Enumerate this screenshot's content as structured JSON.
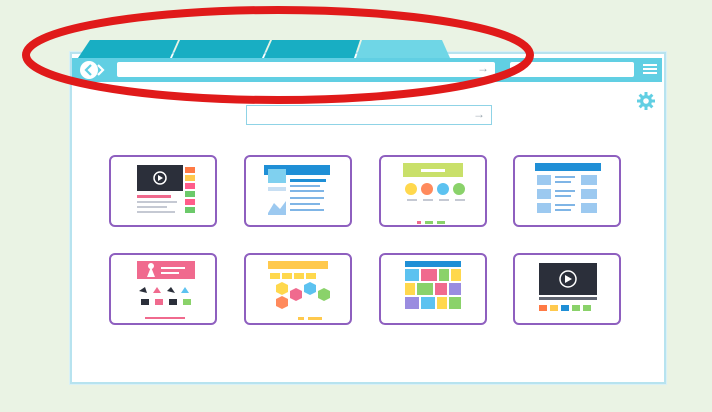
{
  "window": {
    "title": ""
  },
  "tabs": [
    {
      "label": "",
      "active": false
    },
    {
      "label": "",
      "active": false
    },
    {
      "label": "",
      "active": false
    },
    {
      "label": "",
      "active": true
    }
  ],
  "toolbar": {
    "address_value": "",
    "address_icon": "arrow-right-icon",
    "back_icon": "chevron-left-icon",
    "forward_icon": "chevron-right-icon",
    "menu_icon": "hamburger-menu-icon"
  },
  "page": {
    "search_value": "",
    "search_icon": "arrow-right-icon",
    "settings_icon": "gear-icon"
  },
  "thumbnails": [
    {
      "kind": "video-page"
    },
    {
      "kind": "blog-page"
    },
    {
      "kind": "icon-grid-page"
    },
    {
      "kind": "article-page"
    },
    {
      "kind": "shop-page"
    },
    {
      "kind": "hexagon-page"
    },
    {
      "kind": "color-tiles-page"
    },
    {
      "kind": "video-player-page"
    }
  ],
  "annotation": {
    "shape": "ellipse",
    "color": "#e01a1a"
  },
  "colors": {
    "accent": "#61cfe3",
    "tab": "#18aec3",
    "tab_active": "#6fd6e6",
    "thumb_border": "#8e5fbf",
    "background": "#eaf3e4"
  }
}
